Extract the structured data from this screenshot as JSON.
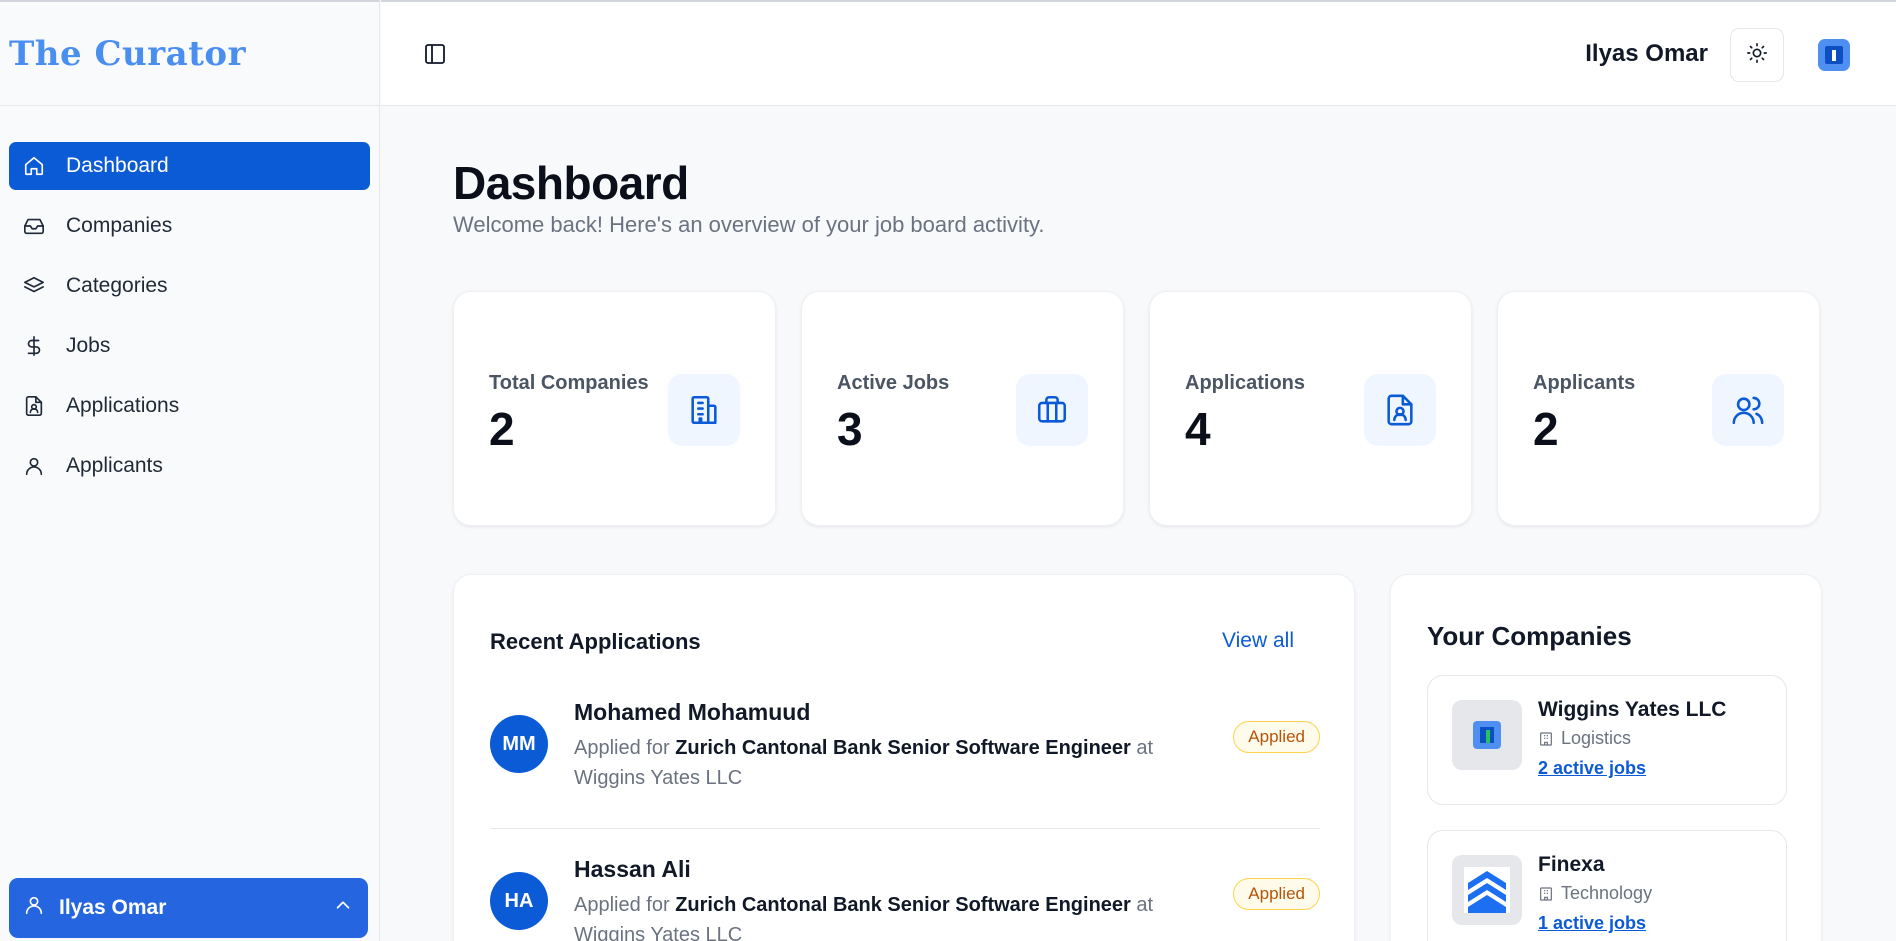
{
  "brand": "The Curator",
  "sidebar": {
    "items": [
      {
        "label": "Dashboard",
        "icon": "home-icon",
        "active": true
      },
      {
        "label": "Companies",
        "icon": "inbox-icon"
      },
      {
        "label": "Categories",
        "icon": "layers-icon"
      },
      {
        "label": "Jobs",
        "icon": "dollar-icon"
      },
      {
        "label": "Applications",
        "icon": "file-user-icon"
      },
      {
        "label": "Applicants",
        "icon": "user-icon"
      }
    ],
    "user": "Ilyas Omar"
  },
  "header": {
    "user_name": "Ilyas Omar"
  },
  "page": {
    "title": "Dashboard",
    "subtitle": "Welcome back! Here's an overview of your job board activity."
  },
  "stats": [
    {
      "label": "Total Companies",
      "value": "2",
      "icon": "building-icon"
    },
    {
      "label": "Active Jobs",
      "value": "3",
      "icon": "briefcase-icon"
    },
    {
      "label": "Applications",
      "value": "4",
      "icon": "file-user-icon"
    },
    {
      "label": "Applicants",
      "value": "2",
      "icon": "users-icon"
    }
  ],
  "recent": {
    "title": "Recent Applications",
    "view_all": "View all",
    "items": [
      {
        "initials": "MM",
        "name": "Mohamed Mohamuud",
        "prefix": "Applied for",
        "job": "Zurich Cantonal Bank Senior Software Engineer",
        "at": "at",
        "company": "Wiggins Yates LLC",
        "status": "Applied"
      },
      {
        "initials": "HA",
        "name": "Hassan Ali",
        "prefix": "Applied for",
        "job": "Zurich Cantonal Bank Senior Software Engineer",
        "at": "at",
        "company": "Wiggins Yates LLC",
        "status": "Applied"
      }
    ]
  },
  "companies": {
    "title": "Your Companies",
    "items": [
      {
        "name": "Wiggins Yates LLC",
        "category": "Logistics",
        "jobs": "2 active jobs"
      },
      {
        "name": "Finexa",
        "category": "Technology",
        "jobs": "1 active jobs"
      }
    ]
  },
  "colors": {
    "accent": "#0b5ad6",
    "brand": "#4a8ff0",
    "badge_text": "#b45309"
  }
}
